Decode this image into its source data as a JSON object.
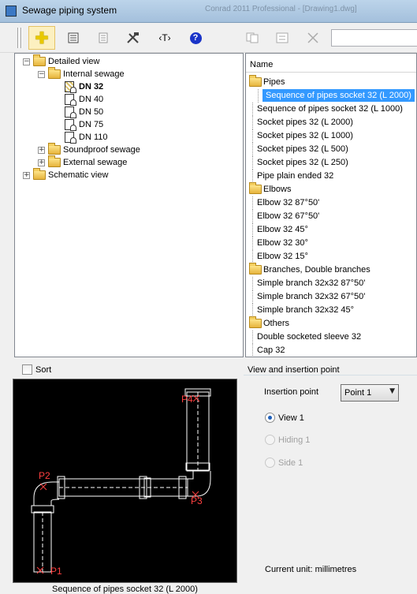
{
  "window": {
    "title": "Sewage piping system",
    "background_title": "Conrad 2011 Professional - [Drawing1.dwg]"
  },
  "toolbar": {
    "text_tool_label": "‹T›",
    "help_label": "?"
  },
  "tree": {
    "nodes": [
      {
        "label": "Detailed view",
        "expander": "−"
      },
      {
        "label": "Internal sewage",
        "expander": "−"
      },
      {
        "label": "DN 32"
      },
      {
        "label": "DN 40"
      },
      {
        "label": "DN 50"
      },
      {
        "label": "DN 75"
      },
      {
        "label": "DN 110"
      },
      {
        "label": "Soundproof sewage",
        "expander": "+"
      },
      {
        "label": "External sewage",
        "expander": "+"
      },
      {
        "label": "Schematic view",
        "expander": "+"
      }
    ]
  },
  "list": {
    "header": "Name",
    "rows": [
      {
        "label": "Pipes"
      },
      {
        "label": "Sequence of pipes socket 32 (L 2000)"
      },
      {
        "label": "Sequence of pipes socket 32 (L 1000)"
      },
      {
        "label": "Socket pipes 32 (L 2000)"
      },
      {
        "label": "Socket pipes 32 (L 1000)"
      },
      {
        "label": "Socket pipes 32 (L 500)"
      },
      {
        "label": "Socket pipes 32 (L 250)"
      },
      {
        "label": "Pipe plain ended 32"
      },
      {
        "label": "Elbows"
      },
      {
        "label": "Elbow 32 87°50'"
      },
      {
        "label": "Elbow 32 67°50'"
      },
      {
        "label": "Elbow 32 45°"
      },
      {
        "label": "Elbow 32 30°"
      },
      {
        "label": "Elbow 32 15°"
      },
      {
        "label": "Branches, Double branches"
      },
      {
        "label": "Simple branch 32x32 87°50'"
      },
      {
        "label": "Simple branch 32x32 67°50'"
      },
      {
        "label": "Simple branch 32x32 45°"
      },
      {
        "label": "Others"
      },
      {
        "label": "Double socketed sleeve 32"
      },
      {
        "label": "Cap 32"
      }
    ]
  },
  "sort": {
    "label": "Sort",
    "checked": false
  },
  "preview": {
    "points": [
      "P1",
      "P2",
      "P3",
      "P4"
    ],
    "caption": "Sequence of pipes socket 32 (L 2000)"
  },
  "insertion": {
    "group_title": "View and insertion point",
    "point_label": "Insertion point",
    "point_value": "Point 1",
    "dropdown_arrow": "▼",
    "views": [
      {
        "label": "View 1",
        "selected": true,
        "enabled": true
      },
      {
        "label": "Hiding 1",
        "selected": false,
        "enabled": false
      },
      {
        "label": "Side 1",
        "selected": false,
        "enabled": false
      }
    ]
  },
  "status": {
    "unit_text": "Current unit: millimetres"
  }
}
